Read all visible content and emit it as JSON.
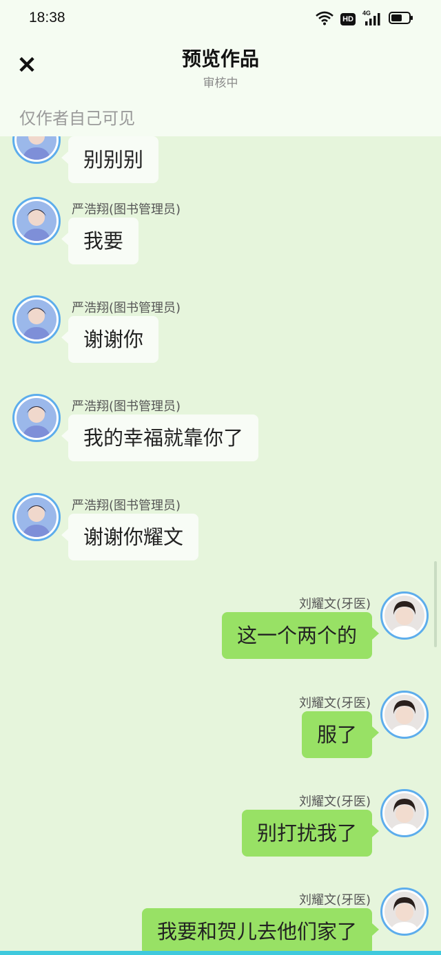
{
  "status_bar": {
    "time": "18:38",
    "hd_label": "HD",
    "network": "4G"
  },
  "header": {
    "close_icon": "close-icon",
    "title": "预览作品",
    "subtitle": "审核中",
    "visibility": "仅作者自己可见"
  },
  "colors": {
    "background": "#e6f5dc",
    "header_background": "#f5fcf2",
    "outgoing_bubble": "#98e165",
    "incoming_bubble": "#f8fcf6",
    "avatar_ring": "#5dadec",
    "bottom_accent": "#3fc9dd"
  },
  "messages": [
    {
      "side": "left",
      "sender": "",
      "text": "别别别"
    },
    {
      "side": "left",
      "sender": "严浩翔(图书管理员)",
      "text": "我要"
    },
    {
      "side": "left",
      "sender": "严浩翔(图书管理员)",
      "text": "谢谢你"
    },
    {
      "side": "left",
      "sender": "严浩翔(图书管理员)",
      "text": "我的幸福就靠你了"
    },
    {
      "side": "left",
      "sender": "严浩翔(图书管理员)",
      "text": "谢谢你耀文"
    },
    {
      "side": "right",
      "sender": "刘耀文(牙医)",
      "text": "这一个两个的"
    },
    {
      "side": "right",
      "sender": "刘耀文(牙医)",
      "text": "服了"
    },
    {
      "side": "right",
      "sender": "刘耀文(牙医)",
      "text": "别打扰我了"
    },
    {
      "side": "right",
      "sender": "刘耀文(牙医)",
      "text": "我要和贺儿去他们家了"
    }
  ]
}
